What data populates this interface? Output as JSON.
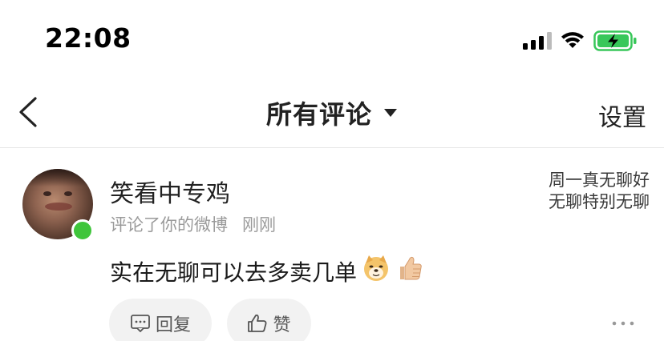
{
  "status_bar": {
    "time": "22:08"
  },
  "header": {
    "title": "所有评论",
    "settings_label": "设置"
  },
  "comment": {
    "username": "笑看中专鸡",
    "action_text": "评论了你的微博",
    "time_ago": "刚刚",
    "text": "实在无聊可以去多卖几单",
    "emojis": [
      "🐶",
      "👍🏼"
    ],
    "quoted_post": "周一真无聊好无聊特别无聊",
    "reply_label": "回复",
    "like_label": "赞"
  },
  "colors": {
    "online": "#3fc53b",
    "battery": "#38c75a",
    "button_bg": "#f2f2f2",
    "meta_text": "#9a9a9a"
  },
  "icons": {
    "back": "chevron-left-icon",
    "dropdown": "triangle-down-icon",
    "reply": "comment-bubble-icon",
    "like": "thumbs-up-icon",
    "more": "ellipsis-icon"
  }
}
